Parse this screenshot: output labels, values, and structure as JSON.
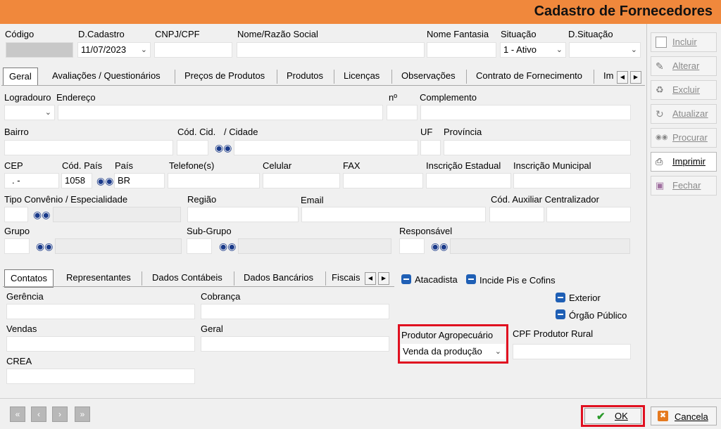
{
  "window": {
    "title": "Cadastro de Fornecedores"
  },
  "header": {
    "codigo_label": "Código",
    "codigo_value": "",
    "dcadastro_label": "D.Cadastro",
    "dcadastro_value": "11/07/2023",
    "cnpj_label": "CNPJ/CPF",
    "cnpj_value": "",
    "nome_label": "Nome/Razão Social",
    "nome_value": "",
    "fantasia_label": "Nome Fantasia",
    "fantasia_value": "",
    "situacao_label": "Situação",
    "situacao_value": "1 - Ativo",
    "dsituacao_label": "D.Situação",
    "dsituacao_value": ""
  },
  "tabs": [
    "Geral",
    "Avaliações / Questionários",
    "Preços de Produtos",
    "Produtos",
    "Licenças",
    "Observações",
    "Contrato de Fornecimento",
    "Im"
  ],
  "geral": {
    "logradouro_label": "Logradouro",
    "endereco_label": "Endereço",
    "numero_label": "nº",
    "complemento_label": "Complemento",
    "bairro_label": "Bairro",
    "cod_cid_label": "Cód. Cid.",
    "cidade_label": "/  Cidade",
    "uf_label": "UF",
    "provincia_label": "Província",
    "cep_label": "CEP",
    "cep_value": ".    -",
    "cod_pais_label": "Cód. País",
    "cod_pais_value": "1058",
    "pais_label": "País",
    "pais_value": "BR",
    "telefone_label": "Telefone(s)",
    "celular_label": "Celular",
    "fax_label": "FAX",
    "ie_label": "Inscrição Estadual",
    "im_label": "Inscrição Municipal",
    "tipo_convenio_label": "Tipo Convênio / Especialidade",
    "regiao_label": "Região",
    "email_label": "Email",
    "cod_aux_label": "Cód. Auxiliar Centralizador",
    "grupo_label": "Grupo",
    "subgrupo_label": "Sub-Grupo",
    "responsavel_label": "Responsável"
  },
  "subtabs": [
    "Contatos",
    "Representantes",
    "Dados Contábeis",
    "Dados Bancários",
    "Fiscais"
  ],
  "contatos": {
    "gerencia_label": "Gerência",
    "cobranca_label": "Cobrança",
    "vendas_label": "Vendas",
    "geral_label": "Geral",
    "crea_label": "CREA"
  },
  "checks": {
    "atacadista": "Atacadista",
    "pis_cofins": "Incide Pis e Cofins",
    "exterior": "Exterior",
    "orgao_publico": "Órgão Público"
  },
  "produtor": {
    "label": "Produtor Agropecuário",
    "value": "Venda  da produção",
    "cpf_label": "CPF Produtor Rural",
    "cpf_value": ""
  },
  "sidebar": {
    "incluir": "Incluir",
    "alterar": "Alterar",
    "excluir": "Excluir",
    "atualizar": "Atualizar",
    "procurar": "Procurar",
    "imprimir": "Imprimir",
    "fechar": "Fechar"
  },
  "footer": {
    "ok": "OK",
    "cancela": "Cancela"
  },
  "colors": {
    "titlebar": "#f0883c",
    "highlight": "#e01020",
    "checkbox": "#1f5fb5"
  }
}
